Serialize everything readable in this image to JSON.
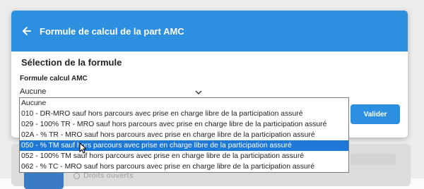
{
  "modal": {
    "title": "Formule de calcul de la part AMC",
    "back_icon": "arrow-left-icon",
    "section_title": "Sélection de la formule",
    "field_label": "Formule calcul AMC",
    "select_value": "Aucune",
    "validate_label": "Valider"
  },
  "dropdown": {
    "selected_index": 5,
    "options": [
      "Aucune",
      "010 - DR-MRO sauf hors parcours avec prise en charge libre de la participation assuré",
      "029 - 100% TR - MRO sauf hors parcours avec prise en charge libre de la participation assuré",
      "02A - % TR - MRO sauf hors parcours avec prise en charge libre de la participation assuré",
      "050 - % TM sauf hors parcours avec prise en charge libre de la participation assuré",
      "052 - 100% TM sauf hors parcours avec prise en charge libre de la participation assuré",
      "062 - % TC - MRO sauf hors parcours avec prise en charge libre de la participation assuré"
    ]
  },
  "background": {
    "status_text": "Droits ouverts"
  },
  "colors": {
    "accent": "#2d8fe0",
    "selected_option": "#1e78d6"
  }
}
